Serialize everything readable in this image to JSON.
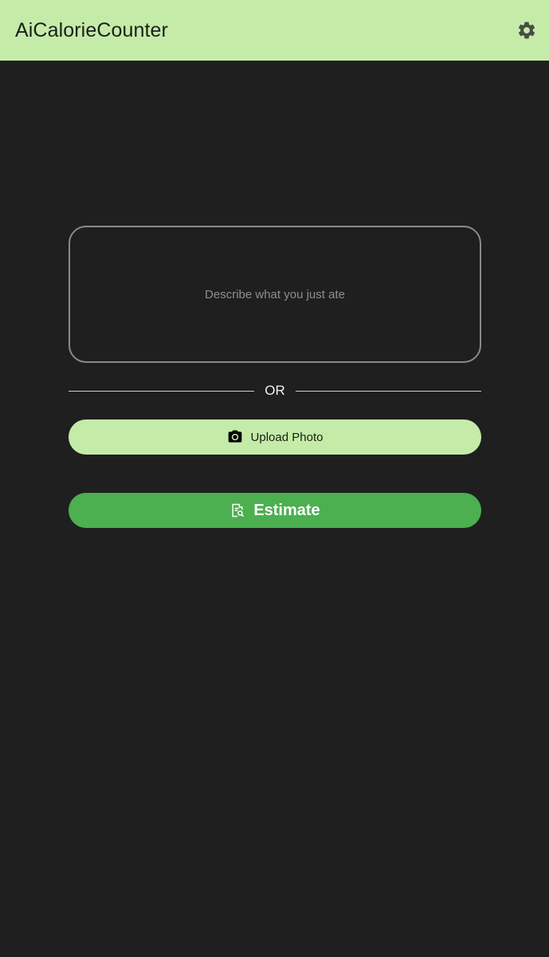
{
  "app_bar": {
    "title": "AiCalorieCounter",
    "settings_icon": "gear-icon",
    "background": "#c5eba9"
  },
  "food_input": {
    "placeholder": "Describe what you just ate",
    "value": ""
  },
  "divider": {
    "label": "OR"
  },
  "upload_button": {
    "label": "Upload Photo",
    "icon": "camera-icon",
    "background": "#c5eba9"
  },
  "estimate_button": {
    "label": "Estimate",
    "icon": "document-search-icon",
    "background": "#4caf50"
  },
  "colors": {
    "page_background": "#1f1f1f",
    "accent_light": "#c5eba9",
    "accent": "#4caf50"
  }
}
